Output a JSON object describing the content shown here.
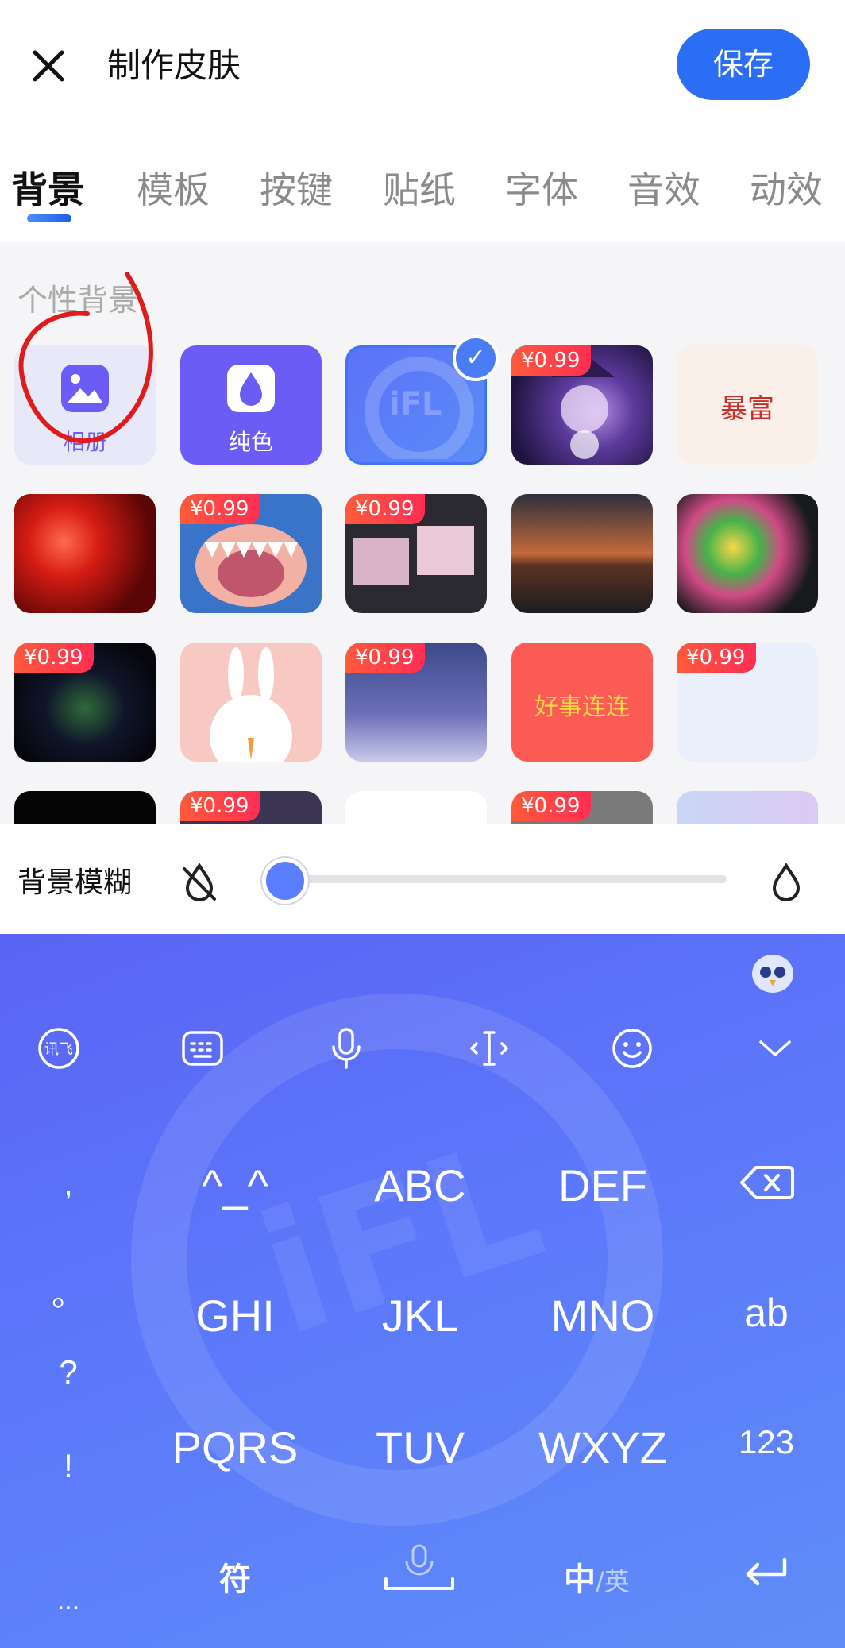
{
  "header": {
    "title": "制作皮肤",
    "save_label": "保存"
  },
  "tabs": [
    {
      "label": "背景",
      "active": true
    },
    {
      "label": "模板",
      "active": false
    },
    {
      "label": "按键",
      "active": false
    },
    {
      "label": "贴纸",
      "active": false
    },
    {
      "label": "字体",
      "active": false
    },
    {
      "label": "音效",
      "active": false
    },
    {
      "label": "动效",
      "active": false
    }
  ],
  "background_panel": {
    "section_title": "个性背景",
    "album_label": "相册",
    "solid_label": "纯色",
    "price": "¥0.99",
    "fortune_text": "暴富",
    "good_luck_text": "好事连连",
    "selected_watermark": "iFL"
  },
  "blur": {
    "label": "背景模糊",
    "value": 0
  },
  "keyboard": {
    "keys_row1": [
      "^_^",
      "ABC",
      "DEF"
    ],
    "keys_row2": [
      "GHI",
      "JKL",
      "MNO"
    ],
    "keys_row3": [
      "PQRS",
      "TUV",
      "WXYZ"
    ],
    "ab": "ab",
    "num": "123",
    "punct": [
      ",",
      "。",
      "?",
      "!",
      "..."
    ],
    "symbol_key": "符",
    "lang_primary": "中",
    "lang_secondary": "/英",
    "watermark": "iFL"
  },
  "colors": {
    "accent": "#2b6df5",
    "price_badge": "#ff3b4e",
    "keyboard": "#5c78fb",
    "annotation": "#e01b1b"
  }
}
